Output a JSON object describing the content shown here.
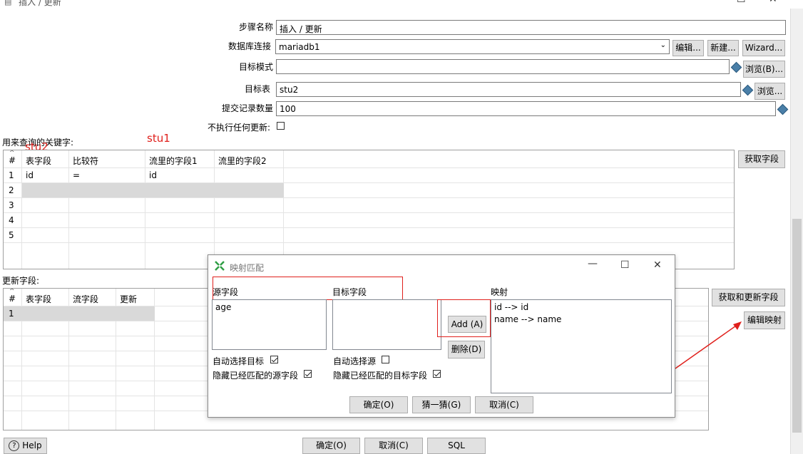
{
  "window": {
    "title": "插入 / 更新"
  },
  "form": {
    "step_name_label": "步骤名称",
    "step_name_value": "插入 / 更新",
    "db_conn_label": "数据库连接",
    "db_conn_value": "mariadb1",
    "edit_btn": "编辑...",
    "new_btn": "新建...",
    "wizard_btn": "Wizard...",
    "schema_label": "目标模式",
    "schema_value": "",
    "browse_b_btn": "浏览(B)...",
    "table_label": "目标表",
    "table_value": "stu2",
    "browse_btn": "浏览...",
    "commit_label": "提交记录数量",
    "commit_value": "100",
    "no_update_label": "不执行任何更新:"
  },
  "key_section": {
    "label": "用来查询的关键字:",
    "get_fields_btn": "获取字段",
    "columns": [
      "#",
      "表字段",
      "比较符",
      "流里的字段1",
      "流里的字段2"
    ],
    "rows": [
      {
        "n": "1",
        "table_field": "id",
        "comparator": "=",
        "stream1": "id",
        "stream2": ""
      },
      {
        "n": "2",
        "table_field": "",
        "comparator": "",
        "stream1": "",
        "stream2": ""
      },
      {
        "n": "3",
        "table_field": "",
        "comparator": "",
        "stream1": "",
        "stream2": ""
      },
      {
        "n": "4",
        "table_field": "",
        "comparator": "",
        "stream1": "",
        "stream2": ""
      },
      {
        "n": "5",
        "table_field": "",
        "comparator": "",
        "stream1": "",
        "stream2": ""
      }
    ]
  },
  "annotations": {
    "stu2": "stu2",
    "stu1": "stu1"
  },
  "update_section": {
    "label": "更新字段:",
    "columns": [
      "#",
      "表字段",
      "流字段",
      "更新"
    ],
    "rows": [
      {
        "n": "1"
      }
    ],
    "get_update_btn": "获取和更新字段",
    "edit_mapping_btn": "编辑映射"
  },
  "dialog": {
    "title": "映射匹配",
    "source_label": "源字段",
    "target_label": "目标字段",
    "mapping_label": "映射",
    "source_items": [
      "age"
    ],
    "target_items": [],
    "mapping_items": [
      "id --> id",
      "name --> name"
    ],
    "add_btn": "Add (A)",
    "delete_btn": "删除(D)",
    "auto_target_label": "自动选择目标",
    "auto_target_checked": true,
    "hide_source_label": "隐藏已经匹配的源字段",
    "hide_source_checked": true,
    "auto_source_label": "自动选择源",
    "auto_source_checked": false,
    "hide_target_label": "隐藏已经匹配的目标字段",
    "hide_target_checked": true,
    "ok_btn": "确定(O)",
    "guess_btn": "猜一猜(G)",
    "cancel_btn": "取消(C)"
  },
  "footer": {
    "help_btn": "Help",
    "ok_btn": "确定(O)",
    "cancel_btn": "取消(C)",
    "sql_btn": "SQL"
  },
  "colors": {
    "annotation_red": "#e0201c",
    "selected_row": "#d9d9d9"
  }
}
